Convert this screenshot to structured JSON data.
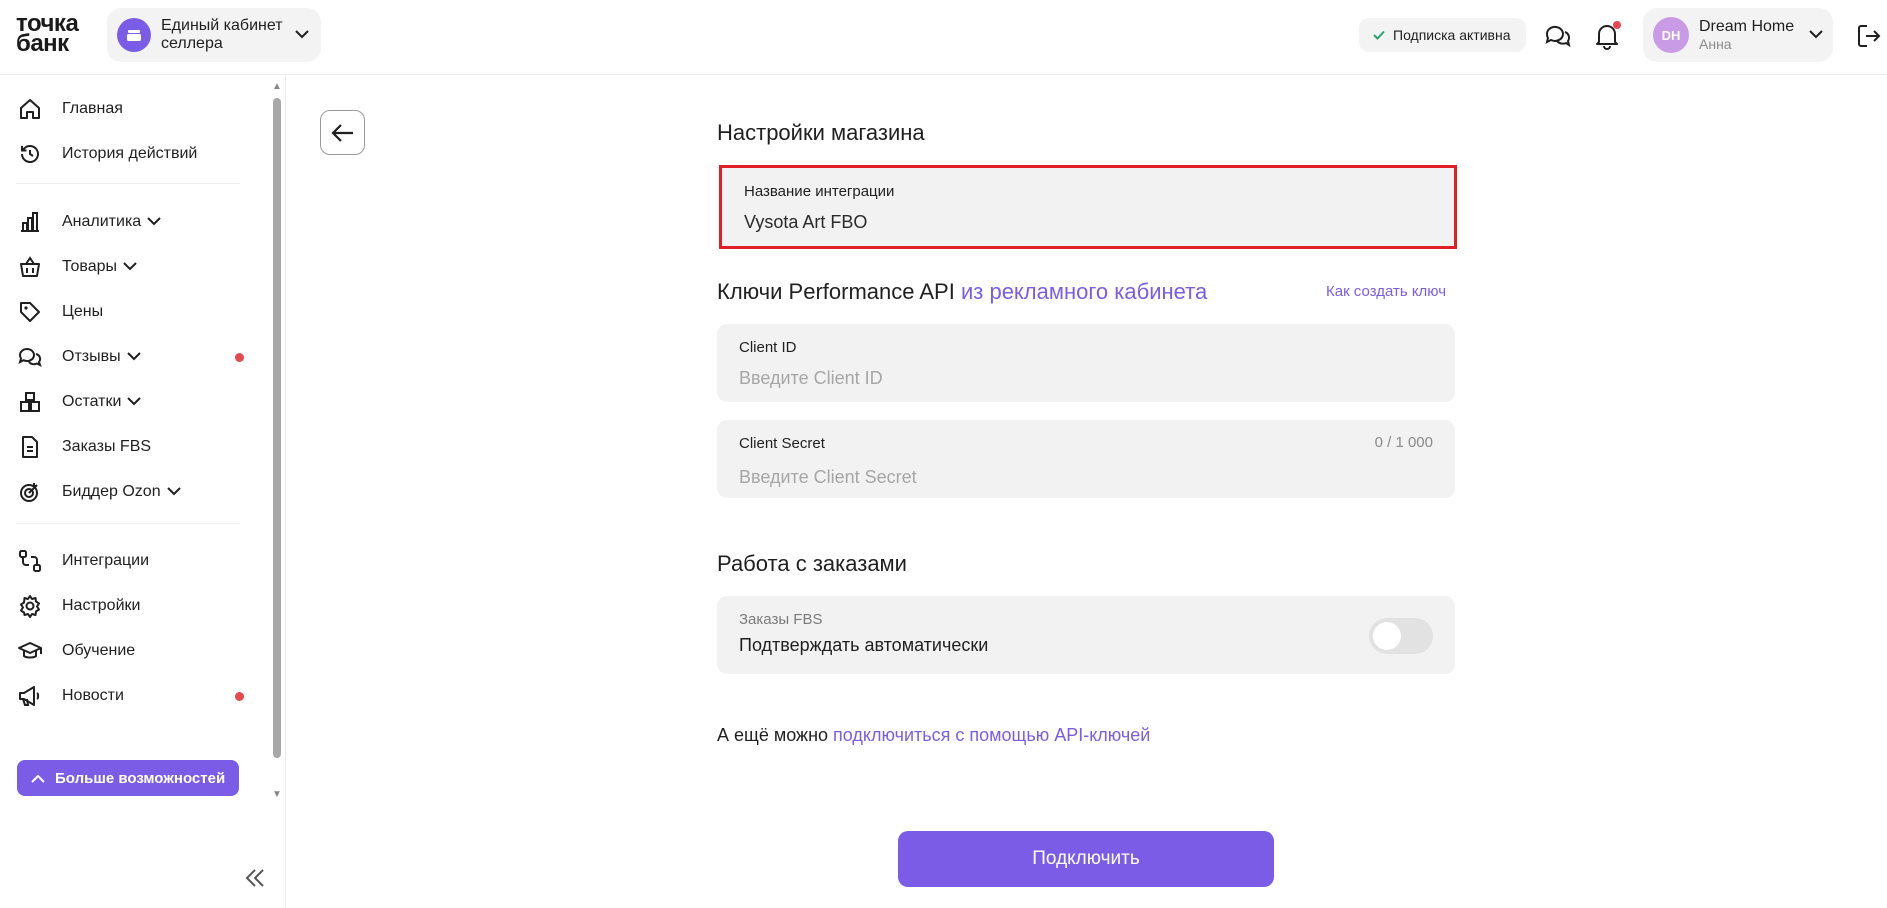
{
  "header": {
    "logo_line1": "точка",
    "logo_line2": "банк",
    "cabinet": "Единый кабинет селлера",
    "subscription": "Подписка активна",
    "user_initials": "DH",
    "user_name": "Dream Home",
    "user_sub": "Анна"
  },
  "sidebar": {
    "items": [
      {
        "label": "Главная",
        "icon": "home-icon"
      },
      {
        "label": "История действий",
        "icon": "history-icon"
      },
      {
        "label": "Аналитика",
        "icon": "analytics-icon"
      },
      {
        "label": "Товары",
        "icon": "basket-icon"
      },
      {
        "label": "Цены",
        "icon": "tag-icon"
      },
      {
        "label": "Отзывы",
        "icon": "chat-icon"
      },
      {
        "label": "Остатки",
        "icon": "boxes-icon"
      },
      {
        "label": "Заказы FBS",
        "icon": "document-icon"
      },
      {
        "label": "Биддер Ozon",
        "icon": "target-icon"
      },
      {
        "label": "Интеграции",
        "icon": "integration-icon"
      },
      {
        "label": "Настройки",
        "icon": "gear-icon"
      },
      {
        "label": "Обучение",
        "icon": "graduation-cap-icon"
      },
      {
        "label": "Новости",
        "icon": "megaphone-icon"
      }
    ],
    "more_button": "Больше возможностей"
  },
  "main": {
    "store_settings_title": "Настройки магазина",
    "integration_name_label": "Название интеграции",
    "integration_name_value": "Vysota Art FBO",
    "api_title_plain": "Ключи Performance API",
    "api_title_link": "из рекламного кабинета",
    "how_to_link": "Как создать ключ",
    "client_id_label": "Client ID",
    "client_id_placeholder": "Введите Client ID",
    "client_secret_label": "Client Secret",
    "client_secret_placeholder": "Введите Client Secret",
    "client_secret_counter": "0 / 1 000",
    "orders_title": "Работа с заказами",
    "orders_sub": "Заказы FBS",
    "orders_toggle_label": "Подтверждать автоматически",
    "orders_toggle_on": false,
    "also_text": "А ещё можно",
    "also_link": "подключиться с помощью API-ключей",
    "connect_button": "Подключить"
  },
  "colors": {
    "accent": "#7b5ce6",
    "alert": "#e5484d",
    "highlight": "#e01f26"
  }
}
